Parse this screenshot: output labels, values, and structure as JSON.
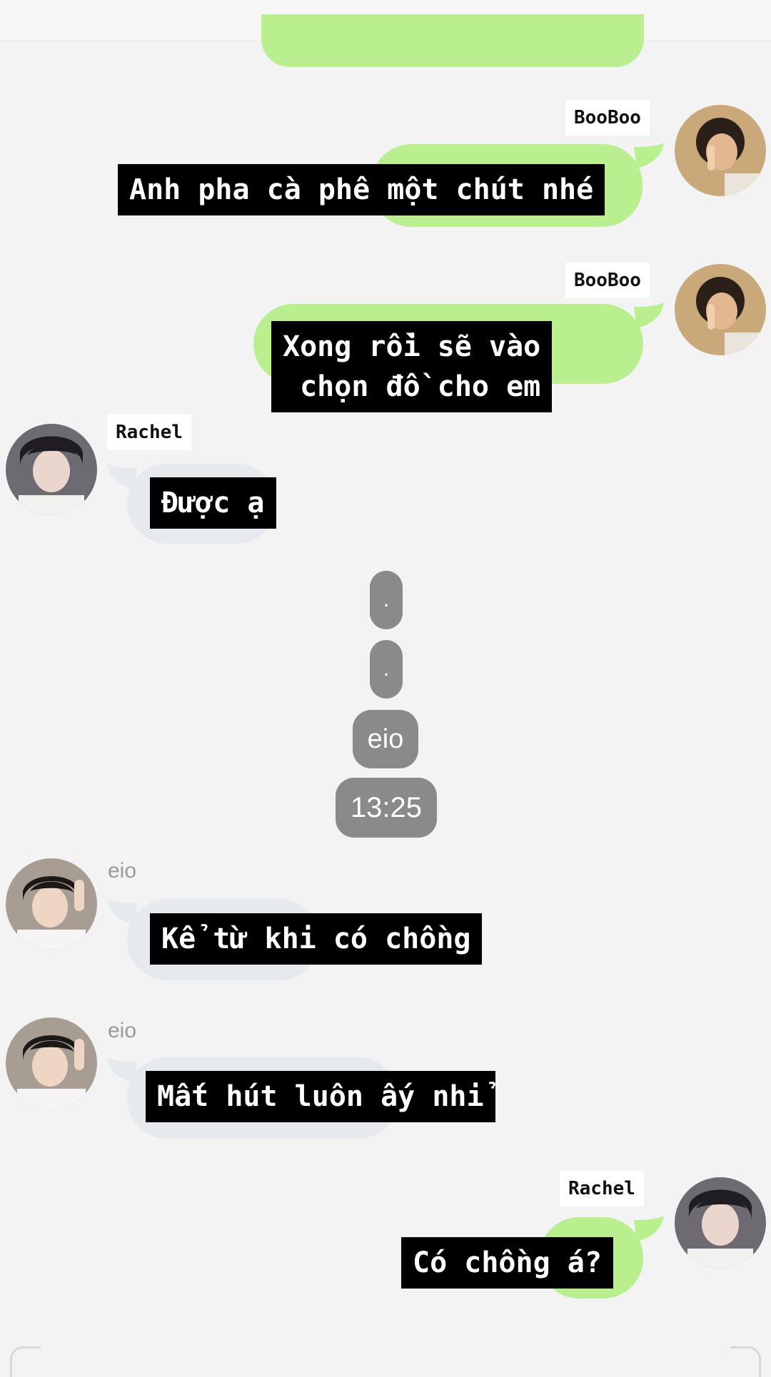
{
  "messages": [
    {
      "sender": "BooBoo",
      "text": "Anh pha cà phê một chút nhé"
    },
    {
      "sender": "BooBoo",
      "text": "Xong rồi sẽ vào\nchọn đồ cho em"
    },
    {
      "sender": "Rachel",
      "text": "Được ạ"
    },
    {
      "sender": "eio",
      "text": "Kể từ khi có chồng"
    },
    {
      "sender": "eio",
      "text": "Mất hút luôn ấy nhỉ"
    },
    {
      "sender": "Rachel",
      "text": "Có chồng á?"
    }
  ],
  "divider": {
    "dot1": ".",
    "dot2": ".",
    "name": "eio",
    "time": "13:25"
  },
  "colors": {
    "background": "#f3f3f4",
    "outgoing_bubble": "#b9ef8f",
    "incoming_bubble": "#e6e9ed",
    "caption_bg": "#000000",
    "pill": "#8a8a8a"
  },
  "icons": [
    "avatar-booboo",
    "avatar-rachel",
    "avatar-eio"
  ]
}
